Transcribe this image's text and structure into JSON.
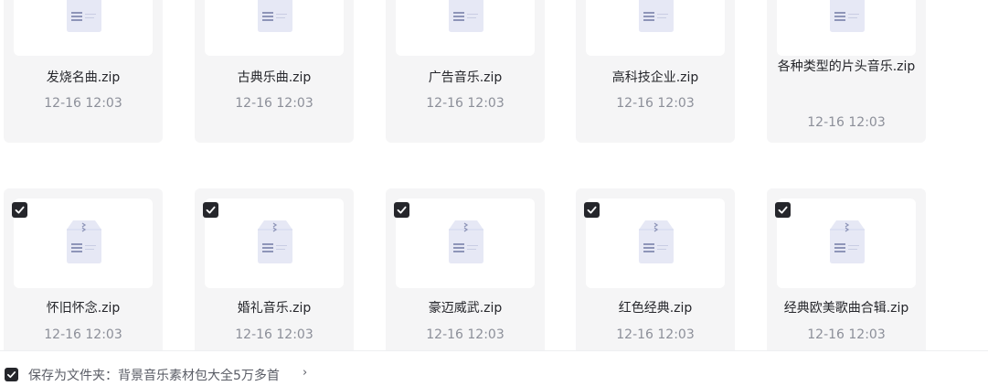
{
  "row1": [
    {
      "name": "发烧名曲.zip",
      "date": "12-16 12:03"
    },
    {
      "name": "古典乐曲.zip",
      "date": "12-16 12:03"
    },
    {
      "name": "广告音乐.zip",
      "date": "12-16 12:03"
    },
    {
      "name": "高科技企业.zip",
      "date": "12-16 12:03"
    },
    {
      "name": "各种类型的片头音乐.zip",
      "date": "12-16 12:03"
    }
  ],
  "row2": [
    {
      "name": "怀旧怀念.zip",
      "date": "12-16 12:03"
    },
    {
      "name": "婚礼音乐.zip",
      "date": "12-16 12:03"
    },
    {
      "name": "豪迈威武.zip",
      "date": "12-16 12:03"
    },
    {
      "name": "红色经典.zip",
      "date": "12-16 12:03"
    },
    {
      "name": "经典欧美歌曲合辑.zip",
      "date": "12-16 12:03"
    }
  ],
  "footer": {
    "save_label": "保存为文件夹：背景音乐素材包大全5万多首",
    "chevron": "›",
    "checked": true
  },
  "colors": {
    "card_bg": "#f5f5f6",
    "check_bg": "#25262b",
    "text": "#25262b",
    "muted": "#8c8f99",
    "icon": "#dfe2f2"
  }
}
